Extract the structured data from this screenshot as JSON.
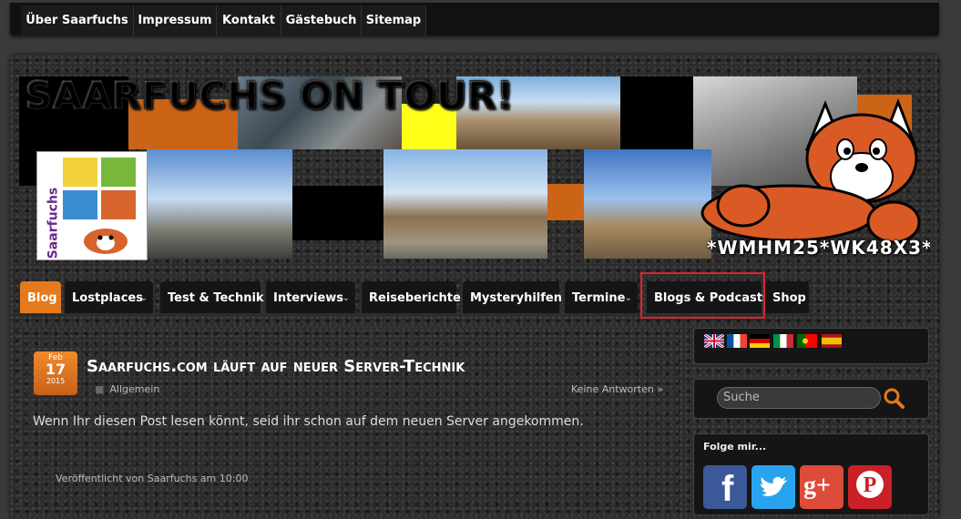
{
  "top_nav": {
    "items": [
      "Über Saarfuchs",
      "Impressum",
      "Kontakt",
      "Gästebuch",
      "Sitemap"
    ]
  },
  "header": {
    "site_title": "SAARFUCHS ON TOUR!",
    "logo_text": "Saarfuchs",
    "gc_code": "*WMHM25*WK48X3*"
  },
  "main_menu": {
    "items": [
      {
        "label": "Blog",
        "active": true,
        "dropdown": false
      },
      {
        "label": "Lostplaces",
        "active": false,
        "dropdown": true
      },
      {
        "label": "Test & Technik",
        "active": false,
        "dropdown": false
      },
      {
        "label": "Interviews",
        "active": false,
        "dropdown": true
      },
      {
        "label": "Reiseberichte",
        "active": false,
        "dropdown": false
      },
      {
        "label": "Mysteryhilfen",
        "active": false,
        "dropdown": false
      },
      {
        "label": "Termine",
        "active": false,
        "dropdown": true
      },
      {
        "label": "Blogs & Podcasts",
        "active": false,
        "dropdown": false
      },
      {
        "label": "Shop",
        "active": false,
        "dropdown": false
      }
    ]
  },
  "post": {
    "date_month": "Feb",
    "date_day": "17",
    "date_year": "2015",
    "title": "Saarfuchs.com läuft auf neuer Server-Technik",
    "category": "Allgemein",
    "replies": "Keine Antworten »",
    "body": "Wenn Ihr diesen Post lesen könnt, seid ihr schon auf dem neuen Server angekommen.",
    "meta": "Veröffentlicht von Saarfuchs am 10:00"
  },
  "sidebar": {
    "flags": [
      "english-flag",
      "french-flag",
      "german-flag",
      "italian-flag",
      "portuguese-flag",
      "spanish-flag"
    ],
    "search_placeholder": "Suche",
    "follow_title": "Folge mir...",
    "social": [
      "facebook-icon",
      "twitter-icon",
      "google-plus-icon",
      "pinterest-icon"
    ]
  },
  "colors": {
    "accent": "#e47a1c",
    "highlight_box": "#d8262a",
    "facebook": "#3b5998",
    "twitter": "#2aa3ef",
    "google_plus": "#dd4b39",
    "pinterest": "#cb2027"
  }
}
